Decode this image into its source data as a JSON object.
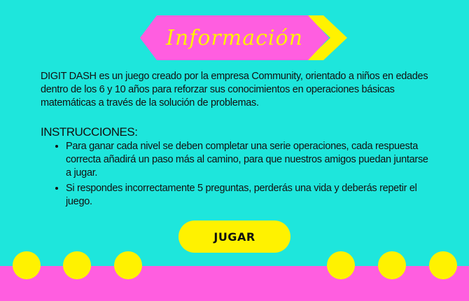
{
  "banner": {
    "title": "Información"
  },
  "intro": "DIGIT DASH es un juego creado por la empresa Community, orientado a niños en edades dentro de los 6 y 10 años para reforzar sus conocimientos en operaciones básicas matemáticas a través de la solución de problemas.",
  "instructions": {
    "heading": "INSTRUCCIONES:",
    "items": [
      "Para ganar cada nivel se deben completar una serie operaciones, cada respuesta correcta añadirá un paso más al camino, para que nuestros amigos puedan juntarse a jugar.",
      "Si respondes incorrectamente 5 preguntas, perderás una vida y deberás repetir el juego."
    ]
  },
  "play_button": {
    "label": "JUGAR"
  },
  "colors": {
    "background": "#1ee6dc",
    "banner": "#ff5ee0",
    "accent": "#fff200",
    "footer": "#ff5ee0"
  }
}
